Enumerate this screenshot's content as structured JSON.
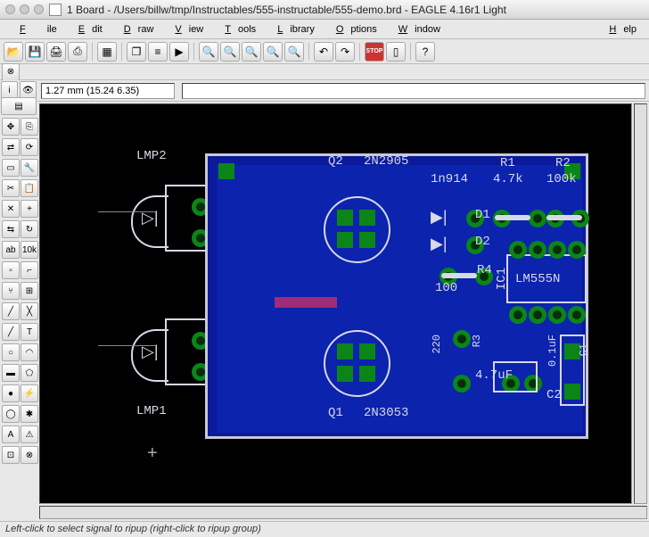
{
  "window": {
    "title": "1 Board - /Users/billw/tmp/Instructables/555-instructable/555-demo.brd - EAGLE 4.16r1 Light"
  },
  "menu": {
    "file": "File",
    "edit": "Edit",
    "draw": "Draw",
    "view": "View",
    "tools": "Tools",
    "library": "Library",
    "options": "Options",
    "window": "Window",
    "help": "Help"
  },
  "toolbar": {
    "open": "📂",
    "save": "💾",
    "print": "🖨",
    "cam": "⎙",
    "board": "▦",
    "sheet": "❐",
    "script": "≡",
    "run": "▶",
    "zoom_fit": "🔍",
    "zoom_in": "🔍",
    "zoom_out": "🔍",
    "zoom_redraw": "🔍",
    "zoom_sel": "🔍",
    "undo": "↶",
    "redo": "↷",
    "stop": "STOP",
    "go": "▯",
    "help_q": "?"
  },
  "params": {
    "coord": "1.27 mm (15.24 6.35)"
  },
  "lefttools": {
    "info": "i",
    "eye": "👁",
    "layers": "▤",
    "move": "✥",
    "copy": "⎘",
    "mirror": "⇄",
    "rotate": "⟳",
    "group": "▭",
    "change": "🔧",
    "cut": "✂",
    "paste": "📋",
    "delete": "✕",
    "add": "+",
    "name": "ab",
    "value": "10k",
    "smash": "▫",
    "miter": "⌐",
    "split": "⑂",
    "route": "╱",
    "ripup": "╳",
    "wire": "╱",
    "text": "T",
    "circle": "○",
    "arc": "◠",
    "rect": "▬",
    "poly": "⬠",
    "via": "●",
    "signal": "⚡",
    "hole": "◯",
    "ratsnest": "✱",
    "auto": "A",
    "erc": "⚠",
    "drc": "⊡",
    "errors": "⊗"
  },
  "pcb": {
    "lmp2": "LMP2",
    "lmp1": "LMP1",
    "q2": "Q2",
    "q2val": "2N2905",
    "q1": "Q1",
    "q1val": "2N3053",
    "r1": "R1",
    "r1val": "4.7k",
    "r2": "R2",
    "r2val": "100k",
    "r3": "R3",
    "r3val": "4.7uF",
    "r4": "R4",
    "r4val": "100",
    "d1": "D1",
    "d2": "D2",
    "dval": "1n914",
    "ic1": "IC1",
    "ic1val": "LM555N",
    "c1": "C1",
    "c1val": "0.1uF",
    "c2": "C2",
    "r3num": "220"
  },
  "status": {
    "text": "Left-click to select signal to ripup (right-click to ripup group)"
  }
}
